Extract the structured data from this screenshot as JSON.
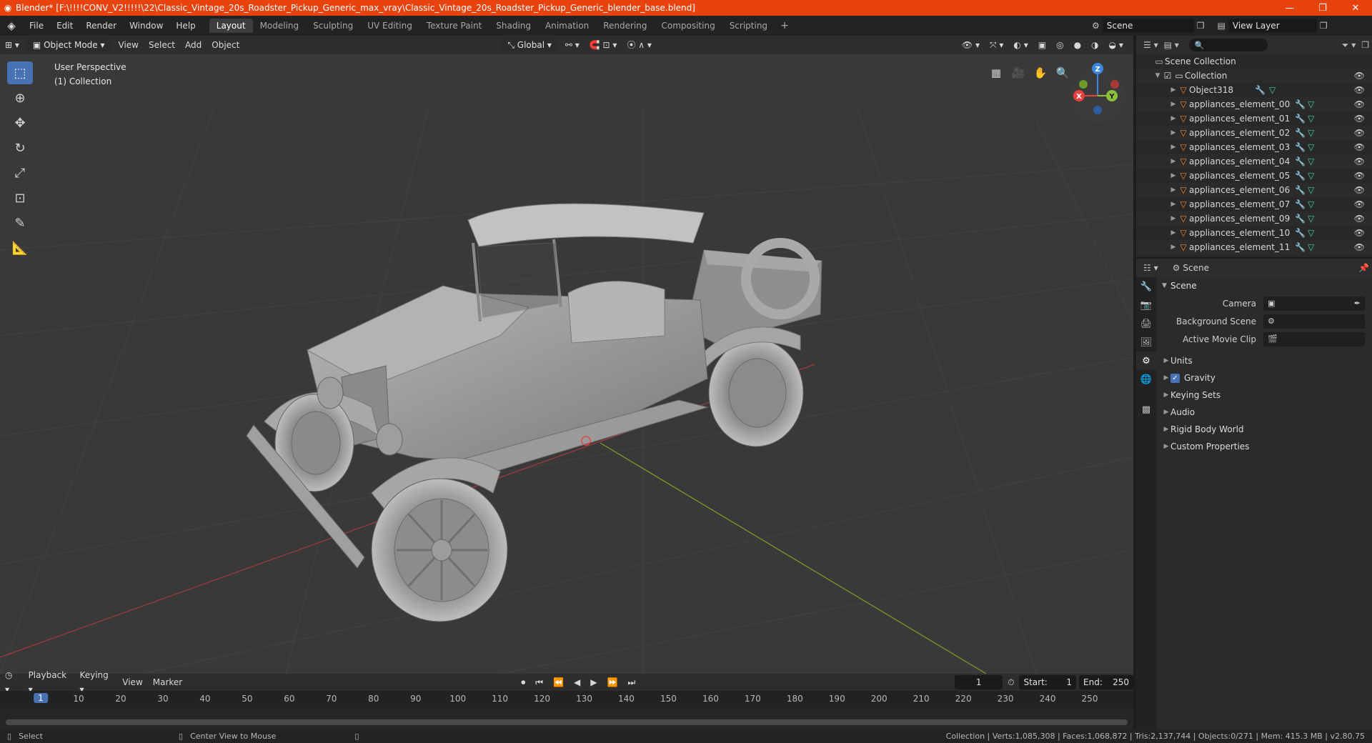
{
  "window": {
    "title": "Blender* [F:\\!!!!CONV_V2!!!!!\\22\\Classic_Vintage_20s_Roadster_Pickup_Generic_max_vray\\Classic_Vintage_20s_Roadster_Pickup_Generic_blender_base.blend]",
    "minimize": "—",
    "maximize": "❐",
    "close": "✕"
  },
  "menu": {
    "file": "File",
    "edit": "Edit",
    "render": "Render",
    "window": "Window",
    "help": "Help"
  },
  "workspaces": [
    "Layout",
    "Modeling",
    "Sculpting",
    "UV Editing",
    "Texture Paint",
    "Shading",
    "Animation",
    "Rendering",
    "Compositing",
    "Scripting"
  ],
  "workspace_active": "Layout",
  "workspace_add": "+",
  "scene_selector": {
    "scene": "Scene",
    "view_layer": "View Layer"
  },
  "viewport": {
    "mode": "Object Mode",
    "view": "View",
    "select": "Select",
    "add": "Add",
    "object": "Object",
    "transform_orientation": "Global",
    "perspective": "User Perspective",
    "collection": "(1) Collection",
    "gizmo": {
      "x": "X",
      "y": "Y",
      "z": "Z"
    }
  },
  "timeline": {
    "playback": "Playback",
    "keying": "Keying",
    "view": "View",
    "marker": "Marker",
    "current_frame": "1",
    "start_label": "Start:",
    "start": "1",
    "end_label": "End:",
    "end": "250",
    "ticks": [
      "10",
      "20",
      "30",
      "40",
      "50",
      "60",
      "70",
      "80",
      "90",
      "100",
      "110",
      "120",
      "130",
      "140",
      "150",
      "160",
      "170",
      "180",
      "190",
      "200",
      "210",
      "220",
      "230",
      "240",
      "250"
    ],
    "current_marker": "1"
  },
  "statusbar": {
    "select": "Select",
    "center_view": "Center View to Mouse",
    "stats": "Collection | Verts:1,085,308 | Faces:1,068,872 | Tris:2,137,744 | Objects:0/271 | Mem: 415.3 MB | v2.80.75"
  },
  "outliner": {
    "scene_collection": "Scene Collection",
    "collection": "Collection",
    "items": [
      "Object318",
      "appliances_element_00",
      "appliances_element_01",
      "appliances_element_02",
      "appliances_element_03",
      "appliances_element_04",
      "appliances_element_05",
      "appliances_element_06",
      "appliances_element_07",
      "appliances_element_09",
      "appliances_element_10",
      "appliances_element_11"
    ]
  },
  "properties": {
    "context": "Scene",
    "panel_title": "Scene",
    "camera_label": "Camera",
    "background_scene_label": "Background Scene",
    "active_movie_clip_label": "Active Movie Clip",
    "subpanels": {
      "units": "Units",
      "gravity": "Gravity",
      "keying_sets": "Keying Sets",
      "audio": "Audio",
      "rigid_body_world": "Rigid Body World",
      "custom_properties": "Custom Properties"
    }
  },
  "colors": {
    "titlebar": "#e8430f",
    "accent": "#4772b3",
    "axis_x": "#e8403f",
    "axis_y": "#8cc23b",
    "axis_z": "#3a86e0"
  }
}
